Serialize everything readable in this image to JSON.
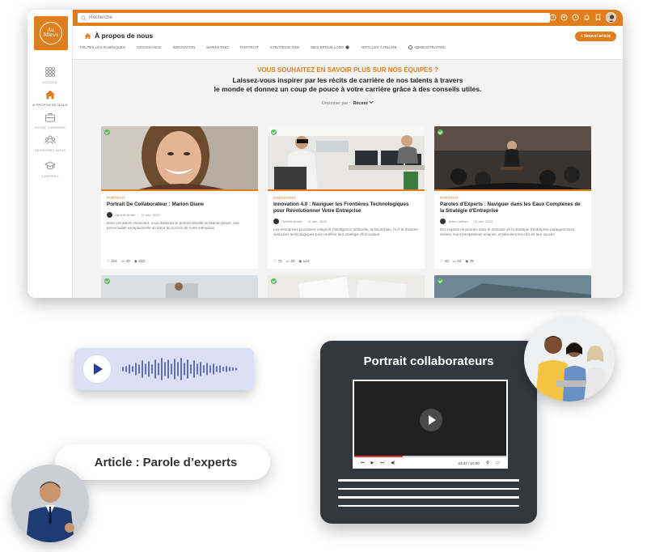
{
  "app": {
    "logo_text": "Au Mieux",
    "search": {
      "placeholder": "Recherche"
    },
    "sidebar": {
      "items": [
        {
          "label": "ACCUEIL"
        },
        {
          "label": "À PROPOS DE NOUS"
        },
        {
          "label": "VOTRE CARRIÈRE"
        },
        {
          "label": "REJOIGNEZ-NOUS"
        },
        {
          "label": "CONTENU"
        }
      ]
    },
    "header": {
      "title": "À propos de nous",
      "new_button": "+ Nouvel article",
      "tabs": [
        "TOUTES LES RUBRIQUES",
        "CROISSANCE",
        "INNOVATION",
        "MARKETING",
        "PORTRAIT",
        "STRATÉGIE RSE",
        "MES BROUILLONS",
        "ARTICLES À RELIRE",
        "ADMINISTRATION"
      ]
    },
    "hero": {
      "question": "VOUS SOUHAITEZ EN SAVOIR PLUS SUR NOS ÉQUIPES ?",
      "line1": "Laissez-vous inspirer par les récits de carrière de nos talents à travers",
      "line2": "le monde et donnez un coup de pouce à votre carrière grâce à des conseils utiles."
    },
    "sort": {
      "label": "Ordonner par :",
      "value": "Récent"
    },
    "cards": [
      {
        "category": "PORTRAIT",
        "title": "Portrait De Collaborateur : Marion Diane",
        "author": "Ophélie André",
        "date": "11 déc. 2023",
        "desc": "Dans cet article émouvant, nous dressons le portrait détaillé de Marion Diane, une personnalité exceptionnelle au cœur du succès de notre entreprise.",
        "likes": "151",
        "comments": "20",
        "views": "213"
      },
      {
        "category": "INNOVATION",
        "title": "Innovation 4.0 : Naviguer les Frontières Technologiques pour Révolutionner Votre Entreprise",
        "author": "Ophélie André",
        "date": "11 déc. 2023",
        "desc": "Les entreprises pionnières intègrent l'intelligence artificielle, la blockchain, l'IoT et d'autres avancées technologiques pour redéfinir leur stratégie d'innovation.",
        "likes": "75",
        "comments": "33",
        "views": "124"
      },
      {
        "category": "PORTRAIT",
        "title": "Paroles d'Experts : Naviguer dans les Eaux Complexes de la Stratégie d'Entreprise",
        "author": "Julien Lefèvre",
        "date": "11 déc. 2023",
        "desc": "Des experts renommés dans le domaine de la stratégie d'entreprise partagent leurs visions, leurs perspectives uniques, et dévoilent les clés de leur succès.",
        "likes": "43",
        "comments": "24",
        "views": "78"
      }
    ]
  },
  "video": {
    "title": "Portrait collaborateurs",
    "time": "03:47 / 10:00",
    "progress": 0.32
  },
  "article_pill": {
    "label": "Article : Parole d’experts"
  },
  "colors": {
    "accent": "#e07d1c",
    "audio_bg": "#dbe0f6",
    "audio_accent": "#2b3f9c",
    "video_card_bg": "#33383e"
  }
}
